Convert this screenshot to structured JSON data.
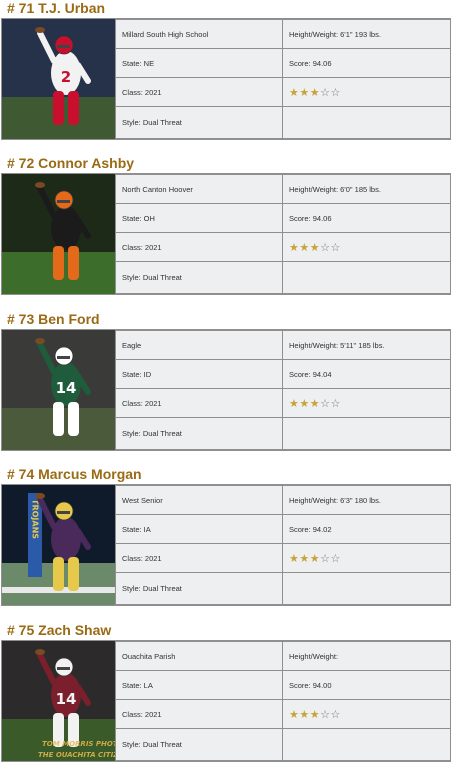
{
  "star_colors": {
    "full": "#c9a23a",
    "empty": "#777777"
  },
  "players": [
    {
      "heading": "# 71 T.J. Urban",
      "school": "Millard South High School",
      "height_weight": "Height/Weight: 6'1\"  193 lbs.",
      "state": "State: NE",
      "score": "Score: 94.06",
      "class": "Class: 2021",
      "stars_filled": 3,
      "stars_total": 5,
      "style": "Style: Dual Threat",
      "jersey": "2",
      "photo_scene": "qb-red-passing",
      "colors": {
        "jersey": "#f2f2f2",
        "trim": "#c8102e",
        "bg": "#26324a",
        "field": "#3f5a33"
      }
    },
    {
      "heading": "# 72 Connor Ashby",
      "school": "North Canton Hoover",
      "height_weight": "Height/Weight: 6'0\"  185 lbs.",
      "state": "State: OH",
      "score": "Score: 94.06",
      "class": "Class: 2021",
      "stars_filled": 3,
      "stars_total": 5,
      "style": "Style: Dual Threat",
      "jersey": "",
      "photo_scene": "qb-orange-running",
      "colors": {
        "jersey": "#1b1b1b",
        "trim": "#e36a1a",
        "bg": "#1e2a18",
        "field": "#3d6d2a"
      }
    },
    {
      "heading": "# 73 Ben Ford",
      "school": "Eagle",
      "height_weight": "Height/Weight: 5'11\"  185 lbs.",
      "state": "State: ID",
      "score": "Score: 94.04",
      "class": "Class: 2021",
      "stars_filled": 3,
      "stars_total": 5,
      "style": "Style: Dual Threat",
      "jersey": "14",
      "photo_scene": "qb-green-throwing",
      "colors": {
        "jersey": "#1f5c3c",
        "trim": "#ffffff",
        "bg": "#3a3a38",
        "field": "#4a5a3a"
      }
    },
    {
      "heading": "# 74 Marcus Morgan",
      "school": "West Senior",
      "height_weight": "Height/Weight: 6'3\"  180 lbs.",
      "state": "State: IA",
      "score": "Score: 94.02",
      "class": "Class: 2021",
      "stars_filled": 3,
      "stars_total": 5,
      "style": "Style: Dual Threat",
      "jersey": "",
      "banner_text": "TROJANS",
      "photo_scene": "qb-night-throwing",
      "colors": {
        "jersey": "#4a2a5a",
        "trim": "#e6c84a",
        "bg": "#0f1a2a",
        "field": "#6a8a6a"
      }
    },
    {
      "heading": "# 75 Zach Shaw",
      "school": "Ouachita Parish",
      "height_weight": "Height/Weight:",
      "state": "State: LA",
      "score": "Score: 94.00",
      "class": "Class: 2021",
      "stars_filled": 3,
      "stars_total": 5,
      "style": "Style: Dual Threat",
      "jersey": "14",
      "watermark": "TOM MORRIS PHOTO / THE OUACHITA CITIZEN",
      "photo_scene": "qb-maroon-passing",
      "colors": {
        "jersey": "#7a1f2b",
        "trim": "#f2f2f2",
        "bg": "#2c2a2a",
        "field": "#3a5a2a"
      }
    }
  ]
}
